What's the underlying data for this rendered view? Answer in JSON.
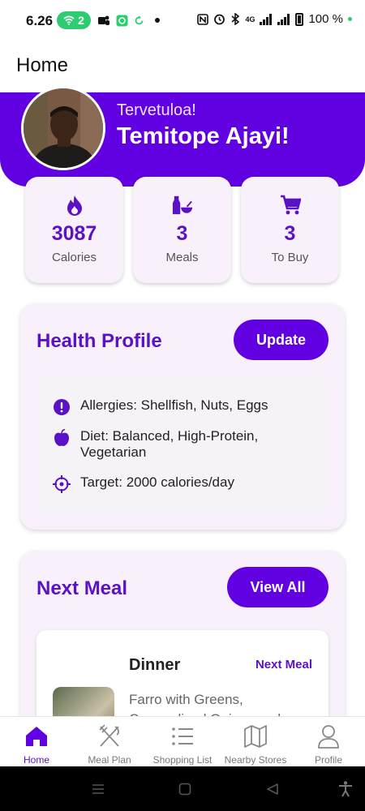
{
  "status_bar": {
    "time": "6.26",
    "hotspot_count": "2",
    "battery_text": "100 %",
    "network_text": "4G"
  },
  "app_bar": {
    "title": "Home"
  },
  "profile": {
    "greeting": "Tervetuloa!",
    "name": "Temitope Ajayi!"
  },
  "stats": [
    {
      "value": "3087",
      "label": "Calories",
      "icon": "flame-icon"
    },
    {
      "value": "3",
      "label": "Meals",
      "icon": "bottle-bowl-icon"
    },
    {
      "value": "3",
      "label": "To Buy",
      "icon": "cart-icon"
    }
  ],
  "health_profile": {
    "title": "Health Profile",
    "button_label": "Update",
    "items": [
      {
        "icon": "alert-circle-icon",
        "text": "Allergies: Shellfish, Nuts, Eggs"
      },
      {
        "icon": "apple-icon",
        "text": "Diet: Balanced, High-Protein, Vegetarian"
      },
      {
        "icon": "crosshair-icon",
        "text": "Target: 2000 calories/day"
      }
    ]
  },
  "next_meal": {
    "title": "Next Meal",
    "button_label": "View All",
    "meal": {
      "type": "Dinner",
      "badge": "Next Meal",
      "name": "Farro with Greens, Caramelized Onions and"
    }
  },
  "bottom_nav": [
    {
      "label": "Home",
      "icon": "home-icon",
      "active": true
    },
    {
      "label": "Meal Plan",
      "icon": "fork-knife-icon",
      "active": false
    },
    {
      "label": "Shopping List",
      "icon": "list-icon",
      "active": false
    },
    {
      "label": "Nearby Stores",
      "icon": "map-icon",
      "active": false
    },
    {
      "label": "Profile",
      "icon": "person-icon",
      "active": false
    }
  ],
  "colors": {
    "primary": "#6100e0",
    "primary_text": "#5b12c7",
    "card_bg": "#f8f0fa"
  }
}
